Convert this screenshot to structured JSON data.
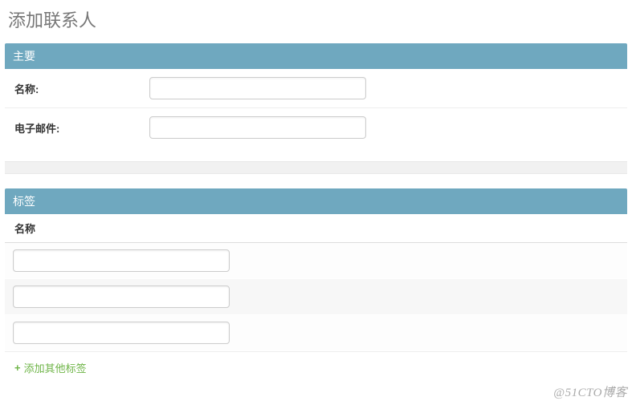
{
  "page": {
    "title": "添加联系人"
  },
  "sections": {
    "main": {
      "header": "主要",
      "fields": {
        "name": {
          "label": "名称:",
          "value": ""
        },
        "email": {
          "label": "电子邮件:",
          "value": ""
        }
      }
    },
    "labels": {
      "header": "标签",
      "column_header": "名称",
      "rows": [
        {
          "value": ""
        },
        {
          "value": ""
        },
        {
          "value": ""
        }
      ],
      "add_link": "添加其他标签"
    }
  },
  "watermark": "@51CTO博客"
}
